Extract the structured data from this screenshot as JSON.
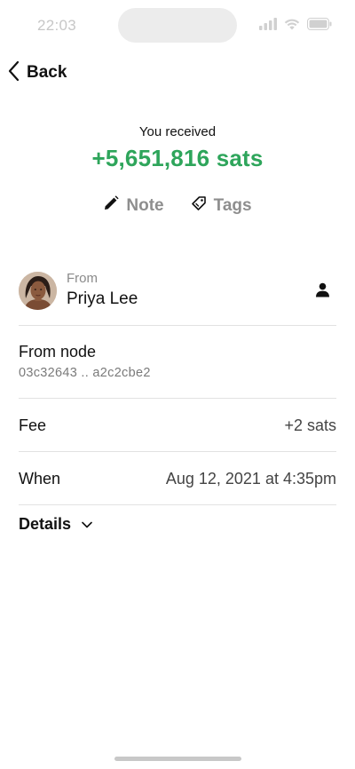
{
  "status_bar": {
    "time": "22:03"
  },
  "nav": {
    "back_label": "Back"
  },
  "header": {
    "received_label": "You received",
    "amount": "+5,651,816 sats",
    "amount_color": "#2ea55b"
  },
  "actions": [
    {
      "label": "Note",
      "icon": "pencil-icon"
    },
    {
      "label": "Tags",
      "icon": "tag-icon"
    }
  ],
  "from": {
    "label": "From",
    "name": "Priya Lee",
    "contact_icon": "person-icon"
  },
  "node": {
    "label": "From node",
    "id": "03c32643 .. a2c2cbe2"
  },
  "fee": {
    "label": "Fee",
    "value": "+2 sats"
  },
  "when": {
    "label": "When",
    "value": "Aug 12, 2021 at 4:35pm"
  },
  "details": {
    "label": "Details",
    "icon": "chevron-down-icon"
  }
}
